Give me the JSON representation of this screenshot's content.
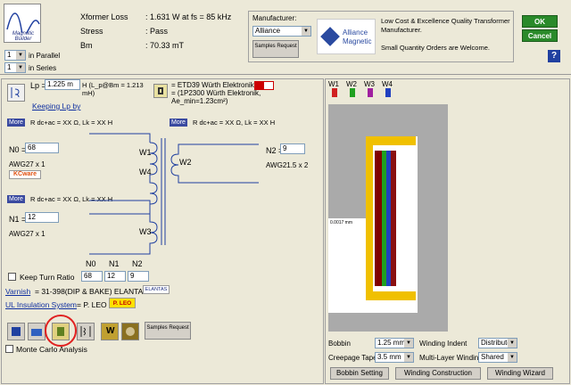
{
  "header": {
    "logo_text": "Magnetic Builder",
    "parallel": {
      "value": "1",
      "label": "in Parallel"
    },
    "series": {
      "value": "1",
      "label": "in Series"
    },
    "xformer_loss_label": "Xformer Loss",
    "xformer_loss_value": ": 1.631 W at fs = 85 kHz",
    "stress_label": "Stress",
    "stress_value": ": Pass",
    "bm_label": "Bm",
    "bm_value": ": 70.33 mT",
    "manufacturer_label": "Manufacturer:",
    "manufacturer_value": "Alliance",
    "samples_request": "Samples Request",
    "brand_line1": "Alliance",
    "brand_line2": "Magnetic",
    "brand_desc": "Low Cost & Excellence Quality Transformer Manufacturer.",
    "brand_desc2": "Small Quantity Orders are Welcome.",
    "ok_label": "OK",
    "cancel_label": "Cancel",
    "help_label": "?"
  },
  "design": {
    "lp_label": "Lp =",
    "lp_value": "1.225 m",
    "lp_suffix": "H (L_p@Bm = 1.213 mH)",
    "keeping_link": "Keeping Lp by",
    "core_line1": "= ETD39 Würth Elektronik",
    "core_line2": "= (1P2300 Würth Elektronik,",
    "core_line3": "Ae_min=1.23cm²)",
    "more1": "More",
    "rdc1": "R dc+ac = XX Ω, Lk = XX H",
    "more2": "More",
    "rdc2": "R dc+ac = XX Ω, Lk = XX H",
    "more3": "More",
    "rdc3": "R dc+ac = XX Ω, Lk = XX H",
    "n0_label": "N0 =",
    "n0_value": "68",
    "awg0": "AWG27 x 1",
    "n1_label": "N1 =",
    "n1_value": "12",
    "awg1": "AWG27 x 1",
    "n2_label": "N2 =",
    "n2_value": "9",
    "awg2": "AWG21.5 x 2",
    "w1": "W1",
    "w2": "W2",
    "w3": "W3",
    "w4": "W4",
    "keep_ratio_label": "Keep Turn Ratio",
    "n0h": "N0",
    "n1h": "N1",
    "n2h": "N2",
    "ratio_vals": [
      "68",
      "12",
      "9"
    ],
    "varnish_link": "Varnish",
    "varnish_value": "= 31-398(DIP & BAKE) ELANTAS",
    "insulation_link": "UL Insulation System",
    "insulation_value": "= P. LEO",
    "elantas": "ELANTAS",
    "pleo": "P. LEO",
    "samples_request2": "Samples Request",
    "monte_carlo": "Monte Carlo Analysis",
    "kcware": "KCware"
  },
  "winding_view": {
    "tabs": [
      "W1",
      "W2",
      "W3",
      "W4"
    ],
    "dim_label": "0.0017 mm",
    "bobbin_label": "Bobbin",
    "bobbin_value": "1.25 mm",
    "winding_indent_label": "Winding Indent",
    "winding_indent_value": "Distribute",
    "creepage_label": "Creepage Tape",
    "creepage_value": "3.5 mm",
    "multilayer_label": "Multi-Layer Winding",
    "multilayer_value": "Shared",
    "bobbin_setting": "Bobbin Setting",
    "winding_construction": "Winding Construction",
    "winding_wizard": "Winding Wizard"
  },
  "colors": {
    "accent": "#2040a0",
    "ok": "#2a8a2a"
  }
}
